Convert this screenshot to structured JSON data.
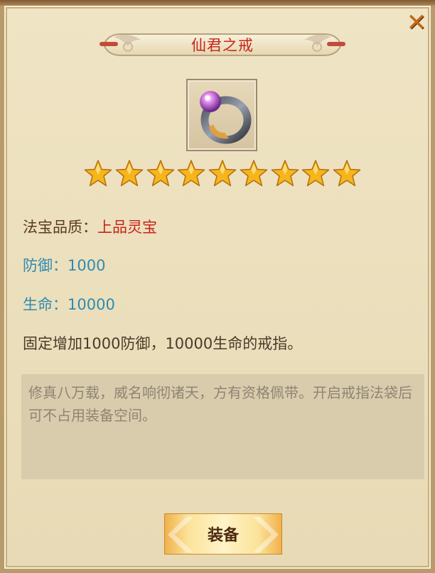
{
  "dialog": {
    "title": "仙君之戒",
    "close_symbol": "✕",
    "item_icon": "ring-icon",
    "stars": 9,
    "quality_label": "法宝品质：",
    "quality_value": "上品灵宝",
    "defense_text": "防御：1000",
    "life_text": "生命：10000",
    "description": "固定增加1000防御，10000生命的戒指。",
    "lore": "修真八万载，威名响彻诸天，方有资格佩带。开启戒指法袋后可不占用装备空间。",
    "equip_label": "装备"
  },
  "colors": {
    "title_red": "#c8231a",
    "stat_blue": "#2f8bb1",
    "panel_bg": "#efe4c4",
    "star_gold": "#f6b51c"
  }
}
